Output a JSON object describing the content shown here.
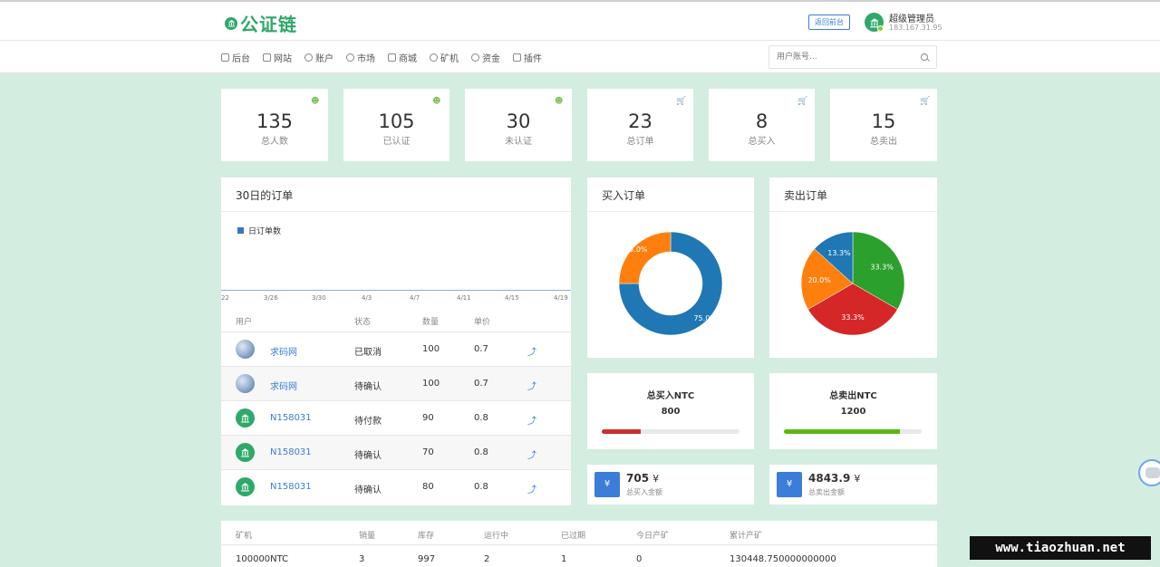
{
  "header": {
    "logo_text": "公证链",
    "back_button": "返回前台",
    "admin_name": "超级管理员",
    "admin_ip": "183.167.31.95"
  },
  "nav": {
    "items": [
      {
        "label": "后台",
        "icon": "home-icon"
      },
      {
        "label": "网站",
        "icon": "list-icon"
      },
      {
        "label": "账户",
        "icon": "users-icon"
      },
      {
        "label": "市场",
        "icon": "globe-icon"
      },
      {
        "label": "商城",
        "icon": "cart-icon"
      },
      {
        "label": "矿机",
        "icon": "machine-icon"
      },
      {
        "label": "资金",
        "icon": "money-icon"
      },
      {
        "label": "插件",
        "icon": "plugin-icon"
      }
    ],
    "search_placeholder": "用户账号..."
  },
  "stats": [
    {
      "value": "135",
      "label": "总人数",
      "icon": "user-icon"
    },
    {
      "value": "105",
      "label": "已认证",
      "icon": "user-icon"
    },
    {
      "value": "30",
      "label": "未认证",
      "icon": "user-icon"
    },
    {
      "value": "23",
      "label": "总订单",
      "icon": "cart-icon"
    },
    {
      "value": "8",
      "label": "总买入",
      "icon": "cart-icon"
    },
    {
      "value": "15",
      "label": "总卖出",
      "icon": "cart-icon"
    }
  ],
  "orders_panel": {
    "title": "30日的订单",
    "legend": "日订单数",
    "ticks": [
      "22",
      "3/26",
      "3/30",
      "4/3",
      "4/7",
      "4/11",
      "4/15",
      "4/19"
    ],
    "columns": [
      "用户",
      "状态",
      "数量",
      "单价"
    ],
    "rows": [
      {
        "avatar": "globe",
        "user": "求码网",
        "status": "已取消",
        "qty": "100",
        "price": "0.7"
      },
      {
        "avatar": "bank",
        "user": "求码网",
        "status": "待确认",
        "qty": "100",
        "price": "0.7"
      },
      {
        "avatar": "bank",
        "user": "N158031",
        "status": "待付款",
        "qty": "90",
        "price": "0.8"
      },
      {
        "avatar": "bank",
        "user": "N158031",
        "status": "待确认",
        "qty": "70",
        "price": "0.8"
      },
      {
        "avatar": "bank",
        "user": "N158031",
        "status": "待确认",
        "qty": "80",
        "price": "0.8"
      }
    ],
    "action_glyph": "⤴"
  },
  "chart_data": [
    {
      "type": "pie",
      "title": "买入订单",
      "donut": true,
      "slices": [
        {
          "value": 75.0,
          "label": "75.0%",
          "color": "#1f77b4"
        },
        {
          "value": 25.0,
          "label": "25.0%",
          "color": "#ff7f0e"
        }
      ]
    },
    {
      "type": "pie",
      "title": "卖出订单",
      "donut": false,
      "slices": [
        {
          "value": 33.3,
          "label": "33.3%",
          "color": "#2ca02c"
        },
        {
          "value": 33.3,
          "label": "33.3%",
          "color": "#d62728"
        },
        {
          "value": 20.0,
          "label": "20.0%",
          "color": "#ff7f0e"
        },
        {
          "value": 13.3,
          "label": "13.3%",
          "color": "#1f77b4"
        }
      ]
    }
  ],
  "totals": {
    "buy": {
      "title": "总买入NTC",
      "value": "800",
      "progress": 0.28,
      "color": "#c9302c"
    },
    "sell": {
      "title": "总卖出NTC",
      "value": "1200",
      "progress": 0.84,
      "color": "#5cb811"
    }
  },
  "amounts": {
    "buy": {
      "value": "705",
      "unit": "¥",
      "label": "总买入金额",
      "icon_glyph": "¥"
    },
    "sell": {
      "value": "4843.9",
      "unit": "¥",
      "label": "总卖出金额",
      "icon_glyph": "¥"
    }
  },
  "miners": {
    "columns": [
      "矿机",
      "销量",
      "库存",
      "运行中",
      "已过期",
      "今日产矿",
      "累计产矿"
    ],
    "rows": [
      [
        "100000NTC",
        "3",
        "997",
        "2",
        "1",
        "0",
        "130448.750000000000"
      ]
    ]
  },
  "watermark": "www.tiaozhuan.net"
}
